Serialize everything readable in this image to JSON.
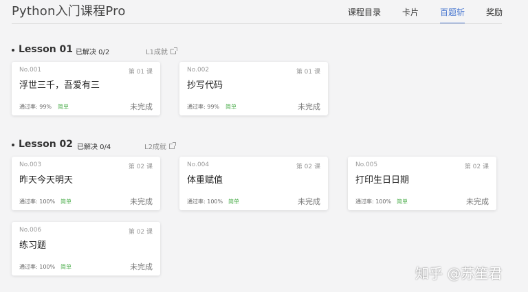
{
  "header": {
    "title": "Python入门课程Pro",
    "tabs": [
      "课程目录",
      "卡片",
      "百题斩",
      "奖励"
    ],
    "active_tab": "百题斩"
  },
  "lessons": [
    {
      "title": "Lesson 01",
      "solved": "已解决 0/2",
      "achievement": "L1成就",
      "cards": [
        {
          "no": "No.001",
          "lesson": "第 01 课",
          "title": "浮世三千，吾爱有三",
          "rate": "通过率: 99%",
          "difficulty": "简单",
          "status": "未完成"
        },
        {
          "no": "No.002",
          "lesson": "第 01 课",
          "title": "抄写代码",
          "rate": "通过率: 99%",
          "difficulty": "简单",
          "status": "未完成"
        }
      ]
    },
    {
      "title": "Lesson 02",
      "solved": "已解决 0/4",
      "achievement": "L2成就",
      "cards": [
        {
          "no": "No.003",
          "lesson": "第 02 课",
          "title": "昨天今天明天",
          "rate": "通过率: 100%",
          "difficulty": "简单",
          "status": "未完成"
        },
        {
          "no": "No.004",
          "lesson": "第 02 课",
          "title": "体重赋值",
          "rate": "通过率: 100%",
          "difficulty": "简单",
          "status": "未完成"
        },
        {
          "no": "No.005",
          "lesson": "第 02 课",
          "title": "打印生日日期",
          "rate": "通过率: 100%",
          "difficulty": "简单",
          "status": "未完成"
        },
        {
          "no": "No.006",
          "lesson": "第 02 课",
          "title": "练习题",
          "rate": "通过率: 100%",
          "difficulty": "简单",
          "status": "未完成"
        }
      ]
    }
  ],
  "watermark": "知乎 @苏笙君",
  "colors": {
    "accent": "#4a78d0",
    "easy": "#4cae4c",
    "background": "#f4f4f5"
  }
}
